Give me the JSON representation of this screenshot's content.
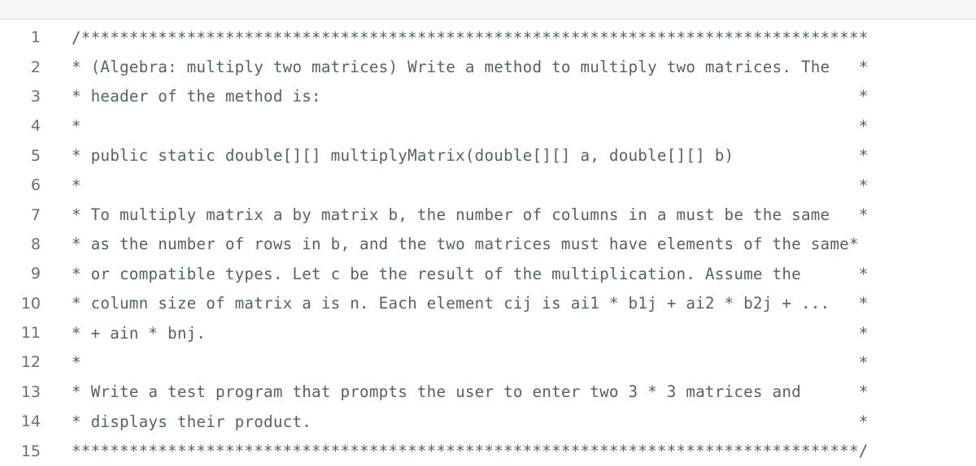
{
  "editor": {
    "trailer_column": 82,
    "lines": [
      {
        "number": "1",
        "text": "/**********************************************************************************",
        "trailer": ""
      },
      {
        "number": "2",
        "text": "* (Algebra: multiply two matrices) Write a method to multiply two matrices. The",
        "trailer": "*"
      },
      {
        "number": "3",
        "text": "* header of the method is:",
        "trailer": "*"
      },
      {
        "number": "4",
        "text": "*",
        "trailer": "*"
      },
      {
        "number": "5",
        "text": "* public static double[][] multiplyMatrix(double[][] a, double[][] b)",
        "trailer": "*"
      },
      {
        "number": "6",
        "text": "*",
        "trailer": "*"
      },
      {
        "number": "7",
        "text": "* To multiply matrix a by matrix b, the number of columns in a must be the same",
        "trailer": "*"
      },
      {
        "number": "8",
        "text": "* as the number of rows in b, and the two matrices must have elements of the same*",
        "trailer": ""
      },
      {
        "number": "9",
        "text": "* or compatible types. Let c be the result of the multiplication. Assume the",
        "trailer": "*"
      },
      {
        "number": "10",
        "text": "* column size of matrix a is n. Each element cij is ai1 * b1j + ai2 * b2j + ...",
        "trailer": "*"
      },
      {
        "number": "11",
        "text": "* + ain * bnj.",
        "trailer": "*"
      },
      {
        "number": "12",
        "text": "*",
        "trailer": "*"
      },
      {
        "number": "13",
        "text": "* Write a test program that prompts the user to enter two 3 * 3 matrices and",
        "trailer": "*"
      },
      {
        "number": "14",
        "text": "* displays their product.",
        "trailer": "*"
      },
      {
        "number": "15",
        "text": "**********************************************************************************/",
        "trailer": ""
      }
    ]
  }
}
